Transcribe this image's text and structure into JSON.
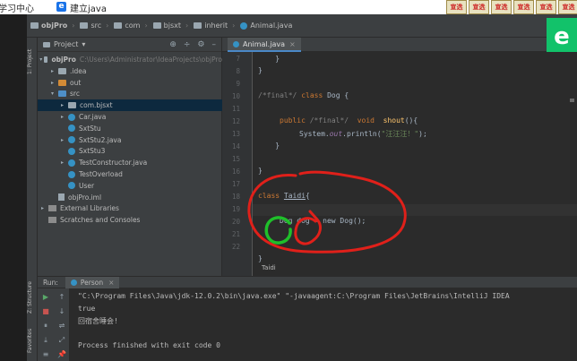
{
  "browser": {
    "tab_a": "学习中心",
    "tab_b": "建立java",
    "edge_glyph": "e"
  },
  "nav": {
    "crumbs": [
      "objPro",
      "src",
      "com",
      "bjsxt",
      "inherit",
      "Animal.java"
    ]
  },
  "toolbar_icons": [
    "宣选",
    "宣选",
    "宣选",
    "宣选",
    "宣选",
    "宣选"
  ],
  "vstrip": {
    "project_label": "1: Project",
    "structure_label": "Z: Structure",
    "favorites_label": "Favorites"
  },
  "project": {
    "title": "Project",
    "dropdown": "▾",
    "header_icons": [
      "⊕",
      "÷",
      "⚙",
      "–"
    ],
    "tree": [
      {
        "label": "objPro",
        "path": "C:\\Users\\Administrator\\IdeaProjects\\objPro",
        "icon": "folder",
        "arrow": "▾",
        "indent": 0
      },
      {
        "label": ".idea",
        "icon": "folder",
        "arrow": "▸",
        "indent": 1
      },
      {
        "label": "out",
        "icon": "folder-orange",
        "arrow": "▸",
        "indent": 1
      },
      {
        "label": "src",
        "icon": "folder-blue",
        "arrow": "▾",
        "indent": 1
      },
      {
        "label": "com.bjsxt",
        "icon": "folder",
        "arrow": "▸",
        "indent": 2,
        "selected": true
      },
      {
        "label": "Car.java",
        "icon": "class",
        "arrow": "▸",
        "indent": 2
      },
      {
        "label": "SxtStu",
        "icon": "class",
        "arrow": "",
        "indent": 2
      },
      {
        "label": "SxtStu2.java",
        "icon": "class",
        "arrow": "▸",
        "indent": 2
      },
      {
        "label": "SxtStu3",
        "icon": "class",
        "arrow": "",
        "indent": 2
      },
      {
        "label": "TestConstructor.java",
        "icon": "class",
        "arrow": "▸",
        "indent": 2
      },
      {
        "label": "TestOverload",
        "icon": "class",
        "arrow": "",
        "indent": 2
      },
      {
        "label": "User",
        "icon": "class",
        "arrow": "",
        "indent": 2
      },
      {
        "label": "objPro.iml",
        "icon": "file",
        "arrow": "",
        "indent": 1
      },
      {
        "label": "External Libraries",
        "icon": "lib",
        "arrow": "▸",
        "indent": 0
      },
      {
        "label": "Scratches and Consoles",
        "icon": "lib",
        "arrow": "",
        "indent": 0
      }
    ]
  },
  "editor": {
    "tab_label": "Animal.java",
    "tab_close": "×",
    "line_numbers": [
      "7",
      "8",
      "9",
      "10",
      "11",
      "12",
      "13",
      "14",
      "15",
      "16",
      "17",
      "18",
      "19",
      "20",
      "21",
      "22"
    ],
    "code": {
      "l7": "    }",
      "l8": "}",
      "l10_comment": "/*final*/",
      "l10_kw": "class",
      "l10_rest": " Dog {",
      "l12_kw": "public",
      "l12_comment": "/*final*/",
      "l12_kw2": "void",
      "l12_fn": "shout",
      "l12_rest": "(){",
      "l13_a": "System.",
      "l13_field": "out",
      "l13_b": ".println(",
      "l13_str": "\"汪汪汪！\"",
      "l13_c": ");",
      "l14": "    }",
      "l16": "}",
      "l18_kw": "class",
      "l18_name": "Taidi",
      "l18_rest": "{",
      "l20": "Dog dog = new Dog();",
      "l22": "}"
    },
    "crumb_hint": "Taidi"
  },
  "run": {
    "label": "Run:",
    "tab": "Person",
    "tab_close": "×",
    "tools": [
      "▶",
      "■",
      "⏸",
      "⤓",
      "≡",
      "🖶",
      "🗑",
      "↑",
      "↓",
      "⇌",
      "⤢",
      "📌"
    ],
    "console": [
      "\"C:\\Program Files\\Java\\jdk-12.0.2\\bin\\java.exe\" \"-javaagent:C:\\Program Files\\JetBrains\\IntelliJ IDEA",
      "true",
      "回宿舍睡会!",
      "",
      "Process finished with exit code 0"
    ]
  },
  "colors": {
    "annotation_red": "#e0201a",
    "annotation_green": "#1fbf2a",
    "keyword": "#cc7832",
    "function": "#ffc66d",
    "string": "#6a8759"
  }
}
